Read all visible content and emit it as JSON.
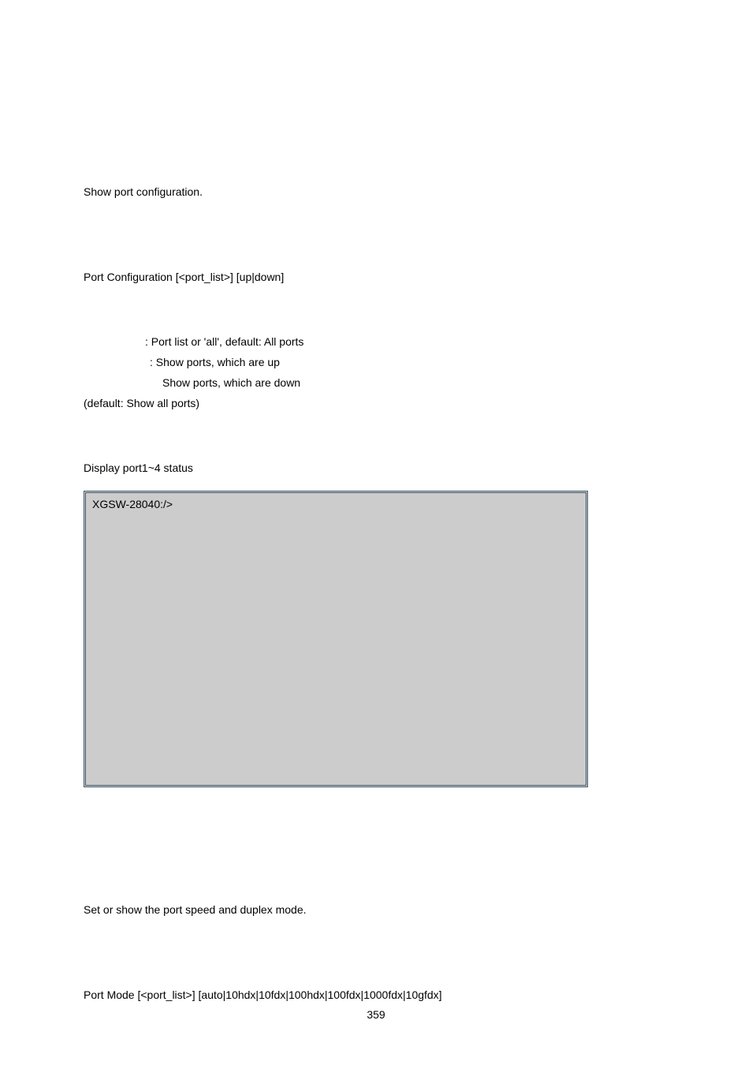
{
  "section1": {
    "desc": "Show port configuration.",
    "syntax": "Port Configuration [<port_list>] [up|down]",
    "param1": ": Port list or 'all', default: All ports",
    "param2": ": Show ports, which are up",
    "param3": "Show ports, which are down",
    "default": "(default: Show all ports)",
    "example_desc": "Display port1~4 status",
    "terminal_prompt": "XGSW-28040:/>"
  },
  "section2": {
    "desc": "Set or show the port speed and duplex mode.",
    "syntax": "Port Mode [<port_list>] [auto|10hdx|10fdx|100hdx|100fdx|1000fdx|10gfdx]"
  },
  "page_number": "359"
}
